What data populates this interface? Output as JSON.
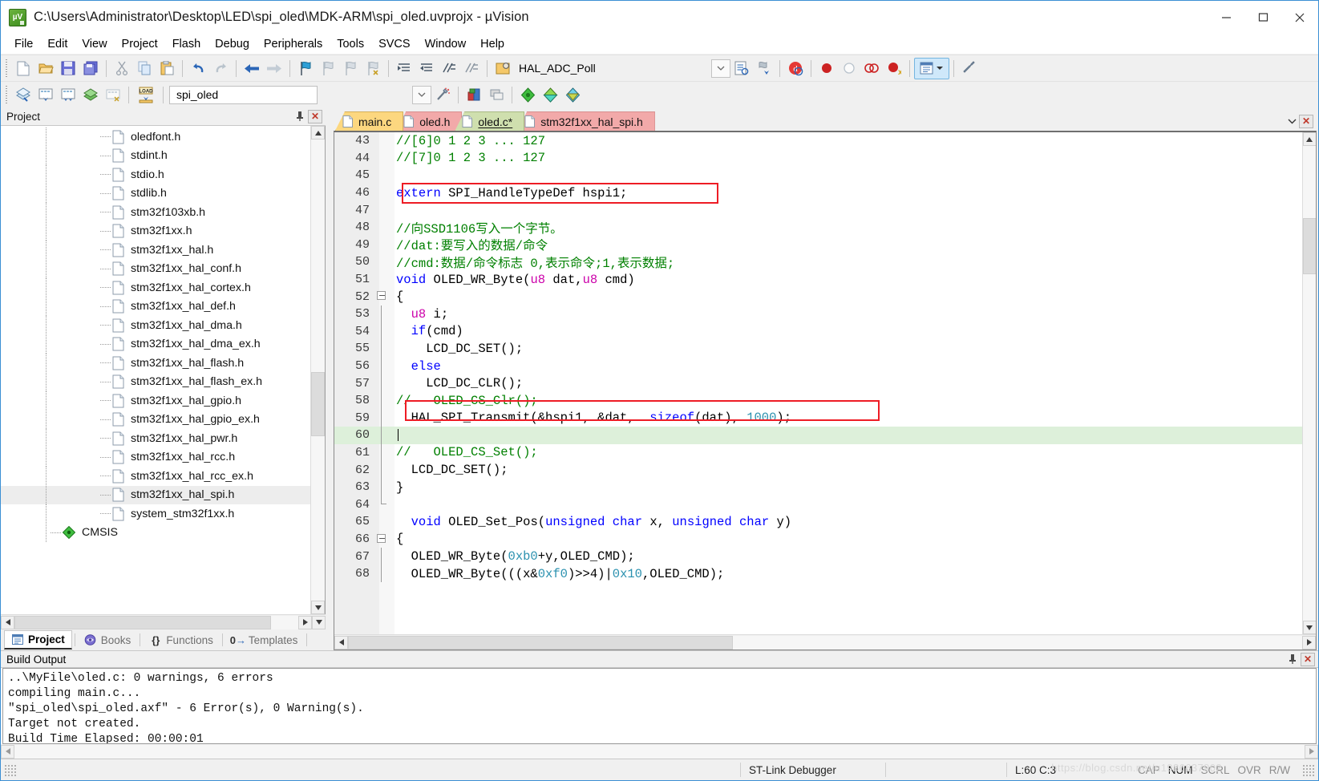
{
  "window": {
    "title": "C:\\Users\\Administrator\\Desktop\\LED\\spi_oled\\MDK-ARM\\spi_oled.uvprojx - µVision",
    "app_icon": "uvision-logo-icon",
    "minimize": "minimize-button",
    "maximize": "maximize-button",
    "close": "close-button"
  },
  "menu": {
    "items": [
      "File",
      "Edit",
      "View",
      "Project",
      "Flash",
      "Debug",
      "Peripherals",
      "Tools",
      "SVCS",
      "Window",
      "Help"
    ]
  },
  "toolbar1": {
    "icons": [
      "new-file-icon",
      "open-file-icon",
      "save-icon",
      "save-all-icon",
      "cut-icon",
      "copy-icon",
      "paste-icon",
      "undo-icon",
      "redo-icon",
      "navigate-back-icon",
      "navigate-forward-icon",
      "bookmark-toggle-icon",
      "bookmark-prev-icon",
      "bookmark-next-icon",
      "bookmark-clear-icon",
      "indent-icon",
      "outdent-icon",
      "comment-icon",
      "uncomment-icon"
    ],
    "target_combo_value": "HAL_ADC_Poll",
    "after_icons": [
      "find-in-files-icon",
      "configure-icon",
      "debug-icon",
      "insert-breakpoint-icon",
      "disable-breakpoint-icon",
      "kill-all-breakpoints-icon",
      "project-window-icon",
      "build-settings-icon"
    ]
  },
  "toolbar2": {
    "icons": [
      "translate-icon",
      "build-icon",
      "rebuild-icon",
      "batch-build-icon",
      "stop-build-icon",
      "download-icon"
    ],
    "project_combo_value": "spi_oled",
    "after_icons": [
      "target-options-icon",
      "manage-run-env-icon",
      "pack-installer-icon",
      "books-icon",
      "functions-icon",
      "templates-icon"
    ]
  },
  "project_panel": {
    "title": "Project",
    "pin_icon": "pin-icon",
    "close_icon": "close-icon",
    "tree": [
      {
        "label": "oledfont.h",
        "icon": "file-icon",
        "selected": false
      },
      {
        "label": "stdint.h",
        "icon": "file-icon",
        "selected": false
      },
      {
        "label": "stdio.h",
        "icon": "file-icon",
        "selected": false
      },
      {
        "label": "stdlib.h",
        "icon": "file-icon",
        "selected": false
      },
      {
        "label": "stm32f103xb.h",
        "icon": "file-icon",
        "selected": false
      },
      {
        "label": "stm32f1xx.h",
        "icon": "file-icon",
        "selected": false
      },
      {
        "label": "stm32f1xx_hal.h",
        "icon": "file-icon",
        "selected": false
      },
      {
        "label": "stm32f1xx_hal_conf.h",
        "icon": "file-icon",
        "selected": false
      },
      {
        "label": "stm32f1xx_hal_cortex.h",
        "icon": "file-icon",
        "selected": false
      },
      {
        "label": "stm32f1xx_hal_def.h",
        "icon": "file-icon",
        "selected": false
      },
      {
        "label": "stm32f1xx_hal_dma.h",
        "icon": "file-icon",
        "selected": false
      },
      {
        "label": "stm32f1xx_hal_dma_ex.h",
        "icon": "file-icon",
        "selected": false
      },
      {
        "label": "stm32f1xx_hal_flash.h",
        "icon": "file-icon",
        "selected": false
      },
      {
        "label": "stm32f1xx_hal_flash_ex.h",
        "icon": "file-icon",
        "selected": false
      },
      {
        "label": "stm32f1xx_hal_gpio.h",
        "icon": "file-icon",
        "selected": false
      },
      {
        "label": "stm32f1xx_hal_gpio_ex.h",
        "icon": "file-icon",
        "selected": false
      },
      {
        "label": "stm32f1xx_hal_pwr.h",
        "icon": "file-icon",
        "selected": false
      },
      {
        "label": "stm32f1xx_hal_rcc.h",
        "icon": "file-icon",
        "selected": false
      },
      {
        "label": "stm32f1xx_hal_rcc_ex.h",
        "icon": "file-icon",
        "selected": false
      },
      {
        "label": "stm32f1xx_hal_spi.h",
        "icon": "file-icon",
        "selected": true
      },
      {
        "label": "system_stm32f1xx.h",
        "icon": "file-icon",
        "selected": false
      },
      {
        "label": "CMSIS",
        "icon": "cmsis-folder-icon",
        "selected": false
      }
    ],
    "bottom_tabs": [
      {
        "label": "Project",
        "icon": "project-icon",
        "active": true
      },
      {
        "label": "Books",
        "icon": "books-icon",
        "active": false
      },
      {
        "label": "Functions",
        "icon": "functions-icon",
        "active": false
      },
      {
        "label": "Templates",
        "icon": "templates-icon",
        "active": false
      }
    ]
  },
  "editor": {
    "tabs": [
      {
        "label": "main.c",
        "style": "main",
        "icon": "c-file-icon"
      },
      {
        "label": "oled.h",
        "style": "header",
        "icon": "h-file-icon"
      },
      {
        "label": "oled.c*",
        "style": "active",
        "icon": "c-file-icon"
      },
      {
        "label": "stm32f1xx_hal_spi.h",
        "style": "header",
        "icon": "h-file-icon"
      }
    ],
    "tab_menu_icon": "chevron-down-icon",
    "tab_close_icon": "close-icon",
    "first_line": 43,
    "current_line": 60,
    "lines": [
      {
        "n": 43,
        "fold": "",
        "segs": [
          {
            "t": "//[6]0 1 2 3 ... 127",
            "c": "cm"
          }
        ]
      },
      {
        "n": 44,
        "fold": "",
        "segs": [
          {
            "t": "//[7]0 1 2 3 ... 127",
            "c": "cm"
          }
        ]
      },
      {
        "n": 45,
        "fold": "",
        "segs": []
      },
      {
        "n": 46,
        "fold": "",
        "segs": [
          {
            "t": "extern",
            "c": "kw"
          },
          {
            "t": " SPI_HandleTypeDef hspi1;",
            "c": "pl"
          }
        ]
      },
      {
        "n": 47,
        "fold": "",
        "segs": []
      },
      {
        "n": 48,
        "fold": "",
        "segs": [
          {
            "t": "//向SSD1106写入一个字节。",
            "c": "cm"
          }
        ]
      },
      {
        "n": 49,
        "fold": "",
        "segs": [
          {
            "t": "//dat:要写入的数据/命令",
            "c": "cm"
          }
        ]
      },
      {
        "n": 50,
        "fold": "",
        "segs": [
          {
            "t": "//cmd:数据/命令标志 0,表示命令;1,表示数据;",
            "c": "cm"
          }
        ]
      },
      {
        "n": 51,
        "fold": "",
        "segs": [
          {
            "t": "void",
            "c": "kw"
          },
          {
            "t": " OLED_WR_Byte(",
            "c": "pl"
          },
          {
            "t": "u8",
            "c": "num"
          },
          {
            "t": " dat,",
            "c": "pl"
          },
          {
            "t": "u8",
            "c": "num"
          },
          {
            "t": " cmd)",
            "c": "pl"
          }
        ]
      },
      {
        "n": 52,
        "fold": "box",
        "segs": [
          {
            "t": "{",
            "c": "pl"
          }
        ]
      },
      {
        "n": 53,
        "fold": "line",
        "segs": [
          {
            "t": "  ",
            "c": "pl"
          },
          {
            "t": "u8",
            "c": "num"
          },
          {
            "t": " i;",
            "c": "pl"
          }
        ]
      },
      {
        "n": 54,
        "fold": "line",
        "segs": [
          {
            "t": "  ",
            "c": "pl"
          },
          {
            "t": "if",
            "c": "kw"
          },
          {
            "t": "(cmd)",
            "c": "pl"
          }
        ]
      },
      {
        "n": 55,
        "fold": "line",
        "segs": [
          {
            "t": "    LCD_DC_SET();",
            "c": "pl"
          }
        ]
      },
      {
        "n": 56,
        "fold": "line",
        "segs": [
          {
            "t": "  ",
            "c": "pl"
          },
          {
            "t": "else",
            "c": "kw"
          }
        ]
      },
      {
        "n": 57,
        "fold": "line",
        "segs": [
          {
            "t": "    LCD_DC_CLR();",
            "c": "pl"
          }
        ]
      },
      {
        "n": 58,
        "fold": "line",
        "segs": [
          {
            "t": "//   OLED_CS_Clr();",
            "c": "cm"
          }
        ]
      },
      {
        "n": 59,
        "fold": "line",
        "segs": [
          {
            "t": "  HAL_SPI_Transmit(&hspi1, &dat,  ",
            "c": "pl"
          },
          {
            "t": "sizeof",
            "c": "kw"
          },
          {
            "t": "(dat), ",
            "c": "pl"
          },
          {
            "t": "1000",
            "c": "ty"
          },
          {
            "t": ");",
            "c": "pl"
          }
        ]
      },
      {
        "n": 60,
        "fold": "line",
        "segs": [],
        "current": true
      },
      {
        "n": 61,
        "fold": "line",
        "segs": [
          {
            "t": "//   OLED_CS_Set();",
            "c": "cm"
          }
        ]
      },
      {
        "n": 62,
        "fold": "line",
        "segs": [
          {
            "t": "  LCD_DC_SET();",
            "c": "pl"
          }
        ]
      },
      {
        "n": 63,
        "fold": "line",
        "segs": [
          {
            "t": "}",
            "c": "pl"
          }
        ]
      },
      {
        "n": 64,
        "fold": "end",
        "segs": []
      },
      {
        "n": 65,
        "fold": "",
        "segs": [
          {
            "t": "  ",
            "c": "pl"
          },
          {
            "t": "void",
            "c": "kw"
          },
          {
            "t": " OLED_Set_Pos(",
            "c": "pl"
          },
          {
            "t": "unsigned",
            "c": "kw"
          },
          {
            "t": " ",
            "c": "pl"
          },
          {
            "t": "char",
            "c": "kw"
          },
          {
            "t": " x, ",
            "c": "pl"
          },
          {
            "t": "unsigned",
            "c": "kw"
          },
          {
            "t": " ",
            "c": "pl"
          },
          {
            "t": "char",
            "c": "kw"
          },
          {
            "t": " y)",
            "c": "pl"
          }
        ]
      },
      {
        "n": 66,
        "fold": "box",
        "segs": [
          {
            "t": "{",
            "c": "pl"
          }
        ]
      },
      {
        "n": 67,
        "fold": "line",
        "segs": [
          {
            "t": "  OLED_WR_Byte(",
            "c": "pl"
          },
          {
            "t": "0xb0",
            "c": "ty"
          },
          {
            "t": "+y,OLED_CMD);",
            "c": "pl"
          }
        ]
      },
      {
        "n": 68,
        "fold": "line",
        "segs": [
          {
            "t": "  OLED_WR_Byte(((x&",
            "c": "pl"
          },
          {
            "t": "0xf0",
            "c": "ty"
          },
          {
            "t": ")>>4)|",
            "c": "pl"
          },
          {
            "t": "0x10",
            "c": "ty"
          },
          {
            "t": ",OLED_CMD);",
            "c": "pl"
          }
        ]
      }
    ],
    "highlight_color": "#ee1c25"
  },
  "build_output": {
    "title": "Build Output",
    "pin_icon": "pin-icon",
    "close_icon": "close-icon",
    "lines": [
      "..\\MyFile\\oled.c: 0 warnings, 6 errors",
      "compiling main.c...",
      "\"spi_oled\\spi_oled.axf\" - 6 Error(s), 0 Warning(s).",
      "Target not created.",
      "Build Time Elapsed:  00:00:01"
    ]
  },
  "statusbar": {
    "debugger": "ST-Link Debugger",
    "cursor": "L:60 C:3",
    "indicators": [
      {
        "label": "CAP",
        "on": false
      },
      {
        "label": "NUM",
        "on": true
      },
      {
        "label": "SCRL",
        "on": false
      },
      {
        "label": "OVR",
        "on": false
      },
      {
        "label": "R/W",
        "on": false
      }
    ],
    "watermark": "https://blog.csdn.net/u1986637902"
  }
}
